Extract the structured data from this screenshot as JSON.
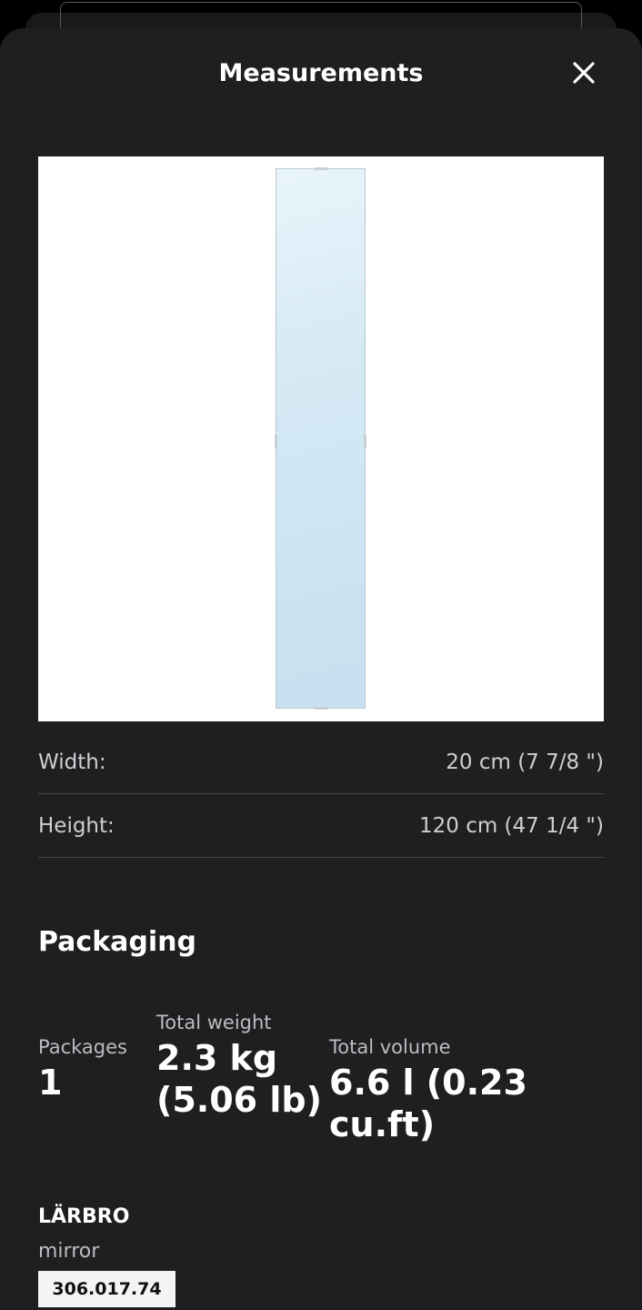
{
  "sheet": {
    "title": "Measurements",
    "close_icon": "close-icon"
  },
  "product_image": {
    "background": "#ffffff",
    "mirror_tint": "#d6eaf5"
  },
  "dimensions": [
    {
      "label": "Width:",
      "value": "20 cm (7 7/8 \")"
    },
    {
      "label": "Height:",
      "value": "120 cm (47 1/4 \")"
    }
  ],
  "packaging": {
    "heading": "Packaging",
    "packages_label": "Packages",
    "packages_value": "1",
    "weight_label": "Total weight",
    "weight_value_line1": "2.3 kg",
    "weight_value_line2": "(5.06 lb)",
    "volume_label": "Total volume",
    "volume_value": "6.6 l (0.23 cu.ft)"
  },
  "product": {
    "name": "LÄRBRO",
    "description": "mirror",
    "article_number": "306.017.74"
  },
  "colors": {
    "sheet_background": "#1f1e21",
    "text_primary": "#ffffff",
    "text_secondary": "#cfcfd2",
    "divider": "#47464a"
  }
}
